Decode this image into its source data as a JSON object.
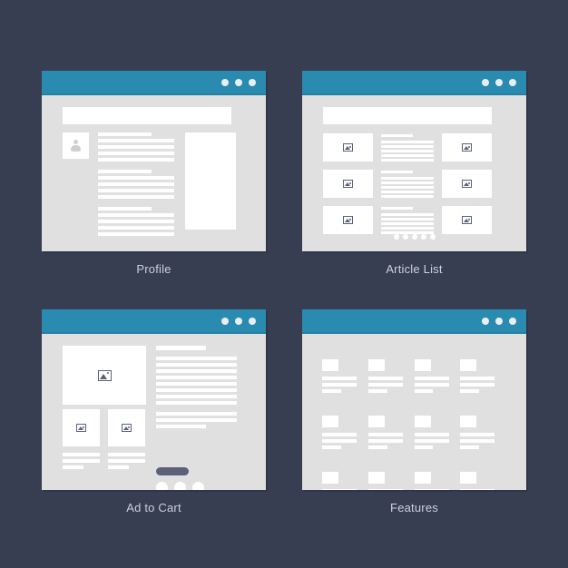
{
  "background_color": "#383e52",
  "accent_color": "#2a8bb0",
  "panel_color": "#e0e0e0",
  "placeholder_color": "#ffffff",
  "button_color": "#5b6179",
  "caption_color": "#ccd1da",
  "cards": [
    {
      "id": "profile",
      "caption": "Profile",
      "window_dots": 3,
      "elements": {
        "search_bar": "search-bar",
        "avatar": "user-avatar",
        "text_paragraphs": 3,
        "sidebar_panel": "side-panel"
      }
    },
    {
      "id": "article-list",
      "caption": "Article List",
      "window_dots": 3,
      "elements": {
        "search_bar": "search-bar",
        "rows": 3,
        "thumbnails_per_row": 2,
        "pagination_dots": 5
      }
    },
    {
      "id": "ad-to-cart",
      "caption": "Ad to Cart",
      "window_dots": 3,
      "elements": {
        "hero_image": "hero-image",
        "thumbnails": 2,
        "description_paragraphs": 2,
        "cta_button": "add-to-cart-button",
        "option_circles": 3
      }
    },
    {
      "id": "features",
      "caption": "Features",
      "window_dots": 3,
      "elements": {
        "grid_columns": 4,
        "grid_rows": 3,
        "feature_cells": 12
      }
    }
  ],
  "icons": {
    "image_placeholder": "image-icon",
    "avatar": "person-icon",
    "window_dot": "window-control-dot"
  }
}
